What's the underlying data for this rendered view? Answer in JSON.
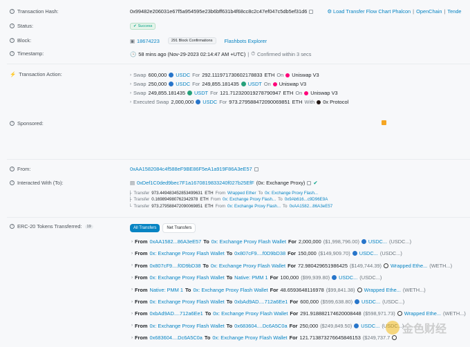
{
  "hash": {
    "label": "Transaction Hash:",
    "value": "0x99482e206031e67f5a954595e23b6bff631b4f68cc8c2c47ef047c5db5ef31d6",
    "links": [
      "Load Transfer Flow Chart Phalcon",
      "OpenChain",
      "Tende"
    ]
  },
  "status": {
    "label": "Status:",
    "value": "Success"
  },
  "block": {
    "label": "Block:",
    "value": "18674223",
    "confirmations": "291 Block Confirmations",
    "explorer": "Flashbots Explorer"
  },
  "timestamp": {
    "label": "Timestamp:",
    "value": "58 mins ago (Nov-29-2023 02:14:47 AM +UTC)",
    "confirmed": "Confirmed within 3 secs"
  },
  "action": {
    "label": "Transaction Action:",
    "items": [
      {
        "verb": "Swap",
        "amount": "600,000",
        "token": "USDC",
        "for": "For",
        "out": "292.111971730602178833",
        "out_token": "ETH",
        "on": "On",
        "dex": "Uniswap V3"
      },
      {
        "verb": "Swap",
        "amount": "250,000",
        "token": "USDC",
        "for": "For",
        "out": "249,855.181435",
        "out_token": "USDT",
        "on": "On",
        "dex": "Uniswap V3"
      },
      {
        "verb": "Swap",
        "amount": "249,855.181435",
        "token": "USDT",
        "for": "For",
        "out": "121.712320019278790947",
        "out_token": "ETH",
        "on": "On",
        "dex": "Uniswap V3"
      },
      {
        "verb": "Executed Swap",
        "amount": "2,000,000",
        "token": "USDC",
        "for": "For",
        "out": "973.279588472090069851",
        "out_token": "ETH",
        "on": "With",
        "dex": "0x Protocol"
      }
    ]
  },
  "sponsored": {
    "label": "Sponsored:"
  },
  "from": {
    "label": "From:",
    "value": "0xAA1582084c4f588eF9BE86F5eA1a919F86A3eE57"
  },
  "interacted": {
    "label": "Interacted With (To):",
    "value": "0xDef1C0ded9bec7F1a1670819833240f027b25EfF",
    "name": "(0x: Exchange Proxy)",
    "transfers": [
      {
        "prefix": "Transfer",
        "amount": "973.449483452853499631",
        "unit": "ETH",
        "from_label": "From",
        "from": "Wrapped Ether",
        "to_label": "To",
        "to": "0x: Exchange Proxy Flash..."
      },
      {
        "prefix": "Transfer",
        "amount": "0.169894980762342978",
        "unit": "ETH",
        "from_label": "From",
        "from": "0x: Exchange Proxy Flash...",
        "to_label": "To",
        "to": "0x9Ab616...c9D96E9A"
      },
      {
        "prefix": "Transfer",
        "amount": "973.279588472090069851",
        "unit": "ETH",
        "from_label": "From",
        "from": "0x: Exchange Proxy Flash...",
        "to_label": "To",
        "to": "0xAA1582...86A3eE57"
      }
    ]
  },
  "erc20": {
    "label": "ERC-20 Tokens Transferred:",
    "count": "19",
    "tabs": [
      "All Transfers",
      "Net Transfers"
    ],
    "rows": [
      {
        "from": "0xAA1582...86A3eE57",
        "to": "0x: Exchange Proxy Flash Wallet",
        "for": "2,000,000",
        "usd": "($1,998,796.00)",
        "token": "USDC...",
        "token2": "(USDC...)",
        "icon": "usdc"
      },
      {
        "from": "0x: Exchange Proxy Flash Wallet",
        "to": "0x807cF9....f0D9bD38",
        "for": "150,000",
        "usd": "($149,909.70)",
        "token": "USDC...",
        "token2": "(USDC...)",
        "icon": "usdc"
      },
      {
        "from": "0x807cF9....f0D9bD38",
        "to": "0x: Exchange Proxy Flash Wallet",
        "for": "72.980429651986425",
        "usd": "($149,744.39)",
        "token": "Wrapped Ethe...",
        "token2": "(WETH...)",
        "icon": "weth"
      },
      {
        "from": "0x: Exchange Proxy Flash Wallet",
        "to": "Native: PMM 1",
        "for": "100,000",
        "usd": "($99,939.80)",
        "token": "USDC...",
        "token2": "(USDC...)",
        "icon": "usdc"
      },
      {
        "from": "Native: PMM 1",
        "to": "0x: Exchange Proxy Flash Wallet",
        "for": "48.6593648116978",
        "usd": "($99,841.38)",
        "token": "Wrapped Ethe...",
        "token2": "(WETH...)",
        "icon": "weth"
      },
      {
        "from": "0x: Exchange Proxy Flash Wallet",
        "to": "0xbAd9AD....712a6Ee1",
        "for": "600,000",
        "usd": "($599,638.80)",
        "token": "USDC...",
        "token2": "(USDC...)",
        "icon": "usdc"
      },
      {
        "from": "0xbAd9AD....712a6Ee1",
        "to": "0x: Exchange Proxy Flash Wallet",
        "for": "291.918882174620008448",
        "usd": "($598,971.73)",
        "token": "Wrapped Ethe...",
        "token2": "(WETH...)",
        "icon": "weth"
      },
      {
        "from": "0x: Exchange Proxy Flash Wallet",
        "to": "0x683604....Dc6A5C0a",
        "for": "250,000",
        "usd": "($249,849.50)",
        "token": "USDC...",
        "token2": "(USDC...)",
        "icon": "usdc"
      },
      {
        "from": "0x683604....Dc6A5C0a",
        "to": "0x: Exchange Proxy Flash Wallet",
        "for": "121.713873276645846153",
        "usd": "($249,737.7",
        "token": "",
        "token2": "",
        "icon": "weth"
      }
    ],
    "from_word": "From",
    "to_word": "To",
    "for_word": "For"
  },
  "watermark": "金色财经"
}
